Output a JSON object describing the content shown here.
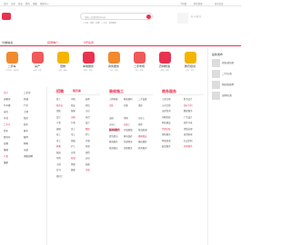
{
  "topbar": {
    "items": [
      "您好",
      "注册",
      "登录",
      "我的",
      "地图",
      "帮助中心",
      "手机版",
      "我的管理",
      "发布信息"
    ]
  },
  "search": {
    "placeholder": "请输入您要搜索的内容",
    "hotwords": "二手房 · 租房 · 招聘 · 二手车 · 家政服务"
  },
  "brand": {
    "accent": "#e8324f"
  },
  "cw_label": "扫一扫关注",
  "nav": {
    "items": [
      "分类信息",
      "招聘推广",
      "VIP会员"
    ]
  },
  "categories": [
    {
      "name": "二手车",
      "sub": "二手轿车 · 面包车",
      "color": "#f28a2d"
    },
    {
      "name": "房产",
      "sub": "出租 · 出售",
      "color": "#ef5a5a"
    },
    {
      "name": "宠物",
      "sub": "狗狗 · 猫咪",
      "color": "#f5b400"
    },
    {
      "name": "本地服务",
      "sub": "搬家 · 保洁",
      "color": "#e8324f"
    },
    {
      "name": "商务服务",
      "sub": "工商 · 财税",
      "color": "#f28a2d"
    },
    {
      "name": "二手市场",
      "sub": "手机 · 电脑",
      "color": "#ef5a5a"
    },
    {
      "name": "农林牧渔",
      "sub": "养殖 · 种植",
      "color": "#e8324f"
    },
    {
      "name": "教育培训",
      "sub": "学历 · 语言",
      "color": "#f5b400"
    }
  ],
  "left": {
    "rows": [
      "房产",
      "二手房",
      "出租房",
      "商铺",
      "写字楼",
      "厂房",
      "仓库",
      "土地",
      "车位",
      "新房",
      "二手车",
      "轿车",
      "货车",
      "客车",
      "摩托车",
      "配件",
      "宠物",
      "狗狗",
      "猫咪",
      "水族",
      "鸟类",
      "求职招聘",
      "兼职"
    ]
  },
  "panels": [
    {
      "title": "招聘",
      "subtitle": "简历库",
      "cells": [
        "普工",
        "司机",
        "厨师",
        "服务员",
        "保安",
        "保洁",
        "销售",
        "客服",
        "文员",
        "会计",
        "出纳",
        "前台",
        "人事",
        "行政",
        "设计",
        "编辑",
        "美工",
        "翻译",
        "技工",
        "电工",
        "焊工",
        "木工",
        "保姆",
        "月嫂",
        "家教",
        "护工",
        "快递",
        "配送",
        "仓管",
        "理货",
        "导购",
        "收银",
        "店员",
        "主管",
        "经理",
        "助理",
        "实习",
        "兼职",
        "全职",
        "临时工"
      ]
    },
    {
      "title": "装修施工",
      "subtitle": "装修服务",
      "cells": [
        "工程机械",
        "家装建材",
        "二手设备",
        "出售",
        "回收",
        "维修",
        "出租",
        "求购",
        "泥水工",
        "水电工",
        "油漆工",
        "拆除",
        "防水补漏",
        "开锁换锁",
        "管道疏通",
        "清洗保洁",
        "家电维修",
        "搬家搬运",
        "家政服务",
        "快递物流",
        "婚庆摄影",
        "旅游酒店",
        "宠物服务",
        "商务服务"
      ]
    },
    {
      "title": "商务服务",
      "subtitle": "",
      "cells": [
        "工商注册",
        "财务会计",
        "公司注销",
        "商标专利",
        "法律咨询",
        "翻译服务",
        "印刷包装",
        "广告设计",
        "网站建设",
        "软件开发",
        "代理记账",
        "资质办理",
        "保险服务",
        "投资担保",
        "物流快递",
        "礼品定制",
        "展会服务",
        "其他服务"
      ]
    }
  ],
  "right": {
    "title": "最新发布",
    "items": [
      "商铺出租急租",
      "二手车出售",
      "家政保姆招聘",
      "宠物狗出售"
    ]
  }
}
